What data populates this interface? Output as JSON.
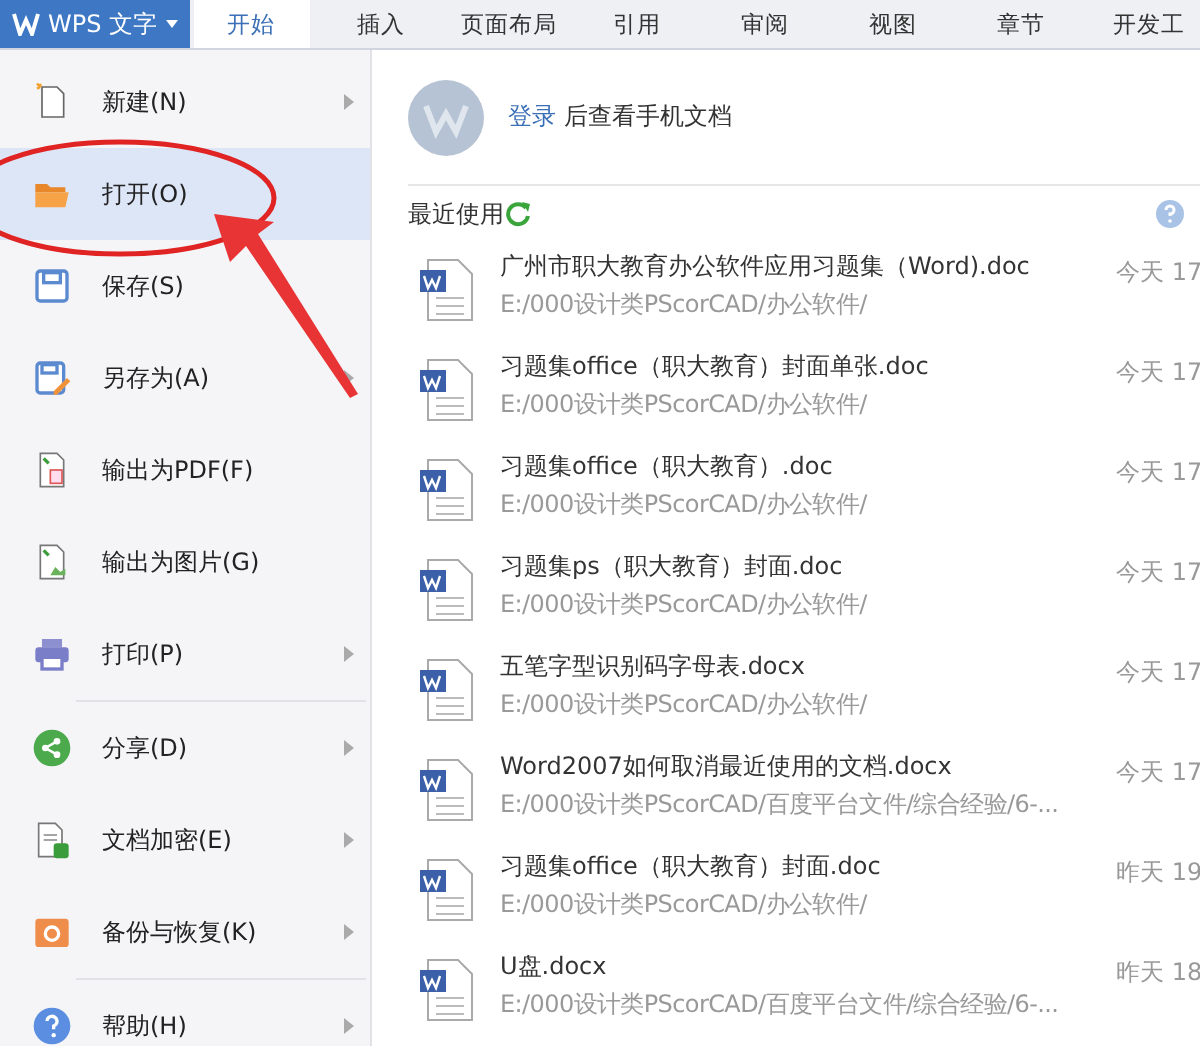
{
  "app_menu": {
    "label": "WPS 文字"
  },
  "tabs": [
    {
      "label": "开始",
      "selected": true
    },
    {
      "label": "插入",
      "selected": false
    },
    {
      "label": "页面布局",
      "selected": false
    },
    {
      "label": "引用",
      "selected": false
    },
    {
      "label": "审阅",
      "selected": false
    },
    {
      "label": "视图",
      "selected": false
    },
    {
      "label": "章节",
      "selected": false
    },
    {
      "label": "开发工",
      "selected": false
    }
  ],
  "menu": [
    {
      "kind": "new",
      "label": "新建(N)",
      "submenu": true,
      "selected": false
    },
    {
      "kind": "open",
      "label": "打开(O)",
      "submenu": false,
      "selected": true
    },
    {
      "kind": "save",
      "label": "保存(S)",
      "submenu": false,
      "selected": false
    },
    {
      "kind": "saveas",
      "label": "另存为(A)",
      "submenu": true,
      "selected": false
    },
    {
      "kind": "pdf",
      "label": "输出为PDF(F)",
      "submenu": false,
      "selected": false
    },
    {
      "kind": "image",
      "label": "输出为图片(G)",
      "submenu": false,
      "selected": false
    },
    {
      "kind": "print",
      "label": "打印(P)",
      "submenu": true,
      "selected": false,
      "divider_after": true
    },
    {
      "kind": "share",
      "label": "分享(D)",
      "submenu": true,
      "selected": false
    },
    {
      "kind": "encrypt",
      "label": "文档加密(E)",
      "submenu": true,
      "selected": false
    },
    {
      "kind": "backup",
      "label": "备份与恢复(K)",
      "submenu": true,
      "selected": false,
      "divider_after": true
    },
    {
      "kind": "help",
      "label": "帮助(H)",
      "submenu": true,
      "selected": false
    }
  ],
  "account": {
    "login_link": "登录",
    "message": "后查看手机文档"
  },
  "recent": {
    "title": "最近使用",
    "files": [
      {
        "name": "广州市职大教育办公软件应用习题集（Word).doc",
        "path": "E:/000设计类PScorCAD/办公软件/",
        "time": "今天 17"
      },
      {
        "name": "习题集office（职大教育）封面单张.doc",
        "path": "E:/000设计类PScorCAD/办公软件/",
        "time": "今天 17"
      },
      {
        "name": "习题集office（职大教育）.doc",
        "path": "E:/000设计类PScorCAD/办公软件/",
        "time": "今天 17"
      },
      {
        "name": "习题集ps（职大教育）封面.doc",
        "path": "E:/000设计类PScorCAD/办公软件/",
        "time": "今天 17"
      },
      {
        "name": "五笔字型识别码字母表.docx",
        "path": "E:/000设计类PScorCAD/办公软件/",
        "time": "今天 17"
      },
      {
        "name": "Word2007如何取消最近使用的文档.docx",
        "path": "E:/000设计类PScorCAD/百度平台文件/综合经验/6-...",
        "time": "今天 17"
      },
      {
        "name": "习题集office（职大教育）封面.doc",
        "path": "E:/000设计类PScorCAD/办公软件/",
        "time": "昨天 19"
      },
      {
        "name": "U盘.docx",
        "path": "E:/000设计类PScorCAD/百度平台文件/综合经验/6-...",
        "time": "昨天 18"
      }
    ]
  }
}
